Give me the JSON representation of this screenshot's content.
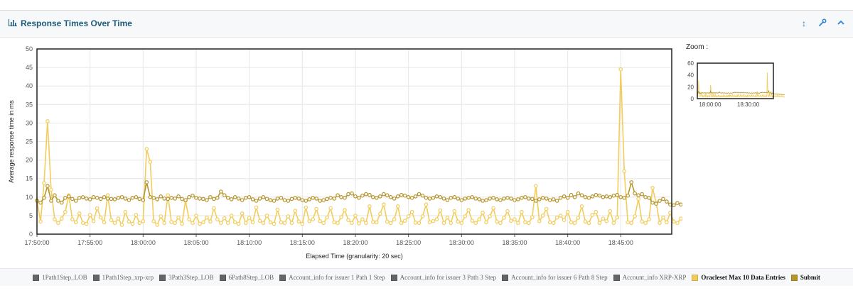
{
  "panel": {
    "title": "Response Times Over Time",
    "title_icon": "bar-chart-icon",
    "actions": [
      {
        "name": "reset-zoom-icon",
        "glyph": "↕"
      },
      {
        "name": "settings-wrench-icon",
        "glyph": "🔧"
      },
      {
        "name": "collapse-chevron-icon",
        "glyph": "⌃"
      }
    ]
  },
  "zoom": {
    "label": "Zoom :",
    "y_ticks": [
      "60",
      "40",
      "20",
      "0"
    ],
    "x_ticks": [
      "18:00:00",
      "18:30:00"
    ]
  },
  "chart_data": {
    "type": "line",
    "title": "",
    "xlabel": "Elapsed Time (granularity: 20 sec)",
    "ylabel": "Average response time in ms",
    "ylim": [
      0,
      50
    ],
    "yticks": [
      0,
      5,
      10,
      15,
      20,
      25,
      30,
      35,
      40,
      45,
      50
    ],
    "xlim": [
      "17:50:00",
      "17:59:50"
    ],
    "x_tick_labels": [
      "17:50:00",
      "17:55:00",
      "18:00:00",
      "18:05:00",
      "18:10:00",
      "18:15:00",
      "18:20:00",
      "18:25:00",
      "18:30:00",
      "18:35:00",
      "18:40:00",
      "18:45:00"
    ],
    "x_tick_minutes": [
      0,
      5,
      10,
      15,
      20,
      25,
      30,
      35,
      40,
      45,
      50,
      55
    ],
    "x_end_minutes": 59.8,
    "point_interval_minutes": 0.3333,
    "grid": true,
    "legend_position": "bottom",
    "series": [
      {
        "name": "Oracleset Max 10 Data Entries",
        "color": "#f2cd5c",
        "values": [
          9.2,
          3.4,
          13.8,
          30.5,
          12.0,
          4.0,
          3.0,
          4.2,
          6.0,
          10.5,
          4.0,
          3.2,
          5.6,
          3.0,
          2.8,
          5.2,
          3.5,
          7.0,
          4.5,
          3.2,
          10.5,
          3.8,
          3.0,
          4.2,
          2.5,
          6.0,
          3.4,
          2.8,
          5.2,
          3.0,
          3.5,
          23.0,
          19.5,
          3.5,
          2.5,
          4.8,
          3.0,
          10.5,
          3.3,
          3.0,
          4.5,
          2.8,
          9.0,
          4.0,
          3.0,
          5.0,
          2.8,
          3.2,
          4.5,
          3.4,
          7.0,
          4.0,
          3.0,
          4.3,
          3.0,
          5.0,
          3.2,
          2.8,
          5.6,
          3.0,
          4.4,
          3.2,
          7.2,
          3.6,
          3.0,
          5.0,
          3.2,
          2.8,
          6.6,
          3.2,
          3.0,
          4.8,
          3.0,
          6.3,
          3.4,
          2.8,
          7.2,
          3.5,
          4.0,
          6.8,
          3.5,
          3.0,
          4.5,
          7.0,
          3.2,
          3.0,
          4.6,
          6.5,
          3.8,
          3.0,
          5.0,
          2.9,
          4.0,
          3.0,
          7.5,
          3.3,
          3.2,
          5.5,
          8.0,
          3.4,
          3.0,
          4.0,
          7.5,
          3.0,
          3.6,
          4.8,
          6.0,
          3.1,
          3.0,
          4.8,
          8.0,
          3.2,
          3.5,
          4.0,
          6.4,
          3.0,
          4.5,
          3.0,
          6.2,
          3.4,
          3.0,
          4.8,
          6.5,
          3.6,
          3.0,
          4.0,
          5.8,
          3.2,
          4.8,
          7.0,
          3.4,
          3.0,
          4.4,
          6.2,
          3.6,
          4.0,
          3.0,
          6.0,
          3.2,
          3.0,
          4.6,
          13.0,
          3.5,
          5.0,
          6.8,
          3.2,
          3.0,
          4.5,
          5.0,
          3.8,
          6.0,
          3.2,
          3.0,
          4.4,
          7.5,
          3.4,
          3.0,
          5.2,
          6.0,
          3.0,
          4.2,
          3.5,
          6.2,
          3.0,
          4.5,
          44.5,
          17.0,
          3.2,
          3.0,
          4.8,
          9.5,
          3.4,
          3.0,
          4.0,
          12.5,
          8.5,
          3.0,
          4.5,
          3.2,
          5.8,
          3.4,
          3.0,
          4.2,
          3.5,
          5.0,
          3.0,
          3.4,
          4.0,
          3.2,
          6.5,
          3.5,
          3.0,
          4.4,
          5.8,
          3.0,
          3.4,
          4.2,
          3.2,
          5.0,
          3.5,
          3.2,
          4.6,
          3.0,
          4.0,
          3.0,
          2.2,
          2.5
        ]
      },
      {
        "name": "Submit",
        "color": "#b5952d",
        "values": [
          9.0,
          8.5,
          9.8,
          13.0,
          9.0,
          10.5,
          9.0,
          8.5,
          9.8,
          10.2,
          9.5,
          9.0,
          9.8,
          10.0,
          9.6,
          9.4,
          10.0,
          9.8,
          9.5,
          10.0,
          9.6,
          9.5,
          9.4,
          9.8,
          10.0,
          9.6,
          9.2,
          9.8,
          10.0,
          9.5,
          9.2,
          14.0,
          10.0,
          9.8,
          9.4,
          10.2,
          9.6,
          9.5,
          9.8,
          9.6,
          10.2,
          9.5,
          9.2,
          10.0,
          10.4,
          9.8,
          9.6,
          9.5,
          9.2,
          10.0,
          9.5,
          9.8,
          11.5,
          10.5,
          9.8,
          9.4,
          10.0,
          9.6,
          9.2,
          9.8,
          10.0,
          9.4,
          9.0,
          9.6,
          10.0,
          9.5,
          9.2,
          9.0,
          9.6,
          9.8,
          9.2,
          9.0,
          9.5,
          9.8,
          9.6,
          9.2,
          9.0,
          9.4,
          9.8,
          9.6,
          9.0,
          9.2,
          9.5,
          9.8,
          9.6,
          10.5,
          10.0,
          9.8,
          10.8,
          11.0,
          10.2,
          9.8,
          10.4,
          10.8,
          10.6,
          10.0,
          9.8,
          10.2,
          10.8,
          10.5,
          10.0,
          9.6,
          10.2,
          10.6,
          10.4,
          10.0,
          9.8,
          10.2,
          10.8,
          10.4,
          9.8,
          9.6,
          9.8,
          10.2,
          10.0,
          9.6,
          9.2,
          9.8,
          10.0,
          9.6,
          9.2,
          9.6,
          9.8,
          10.0,
          9.6,
          9.4,
          9.0,
          9.2,
          9.6,
          9.8,
          9.4,
          9.2,
          9.6,
          9.8,
          9.6,
          9.2,
          9.4,
          9.8,
          10.0,
          9.6,
          9.5,
          9.0,
          9.4,
          9.8,
          9.6,
          9.2,
          9.4,
          9.0,
          9.8,
          10.2,
          9.8,
          10.6,
          10.0,
          11.0,
          10.5,
          10.0,
          9.8,
          10.2,
          10.6,
          10.4,
          10.0,
          10.2,
          10.0,
          10.4,
          10.6,
          10.0,
          9.8,
          10.4,
          14.0,
          11.0,
          10.5,
          10.8,
          10.0,
          9.8,
          8.5,
          8.2,
          9.0,
          9.5,
          8.8,
          8.0,
          7.8,
          8.4,
          8.0,
          7.6,
          8.2,
          7.8,
          8.0,
          7.6,
          7.4,
          7.8,
          8.0,
          7.6,
          7.4,
          7.2,
          7.6,
          7.0,
          7.2,
          7.4,
          7.0,
          6.8,
          7.2,
          7.0,
          6.8,
          6.6,
          6.5,
          6.2,
          6.0
        ]
      }
    ]
  },
  "legend": [
    {
      "label": "1Path1Step_LOB",
      "color": "#666666",
      "active": false
    },
    {
      "label": "1Path1Step_xrp-xrp",
      "color": "#666666",
      "active": false
    },
    {
      "label": "3Path3Step_LOB",
      "color": "#666666",
      "active": false
    },
    {
      "label": "6Path8Step_LOB",
      "color": "#666666",
      "active": false
    },
    {
      "label": "Account_info for issuer 1 Path 1 Step",
      "color": "#666666",
      "active": false
    },
    {
      "label": "Account_info for issuer 3 Path 3 Step",
      "color": "#666666",
      "active": false
    },
    {
      "label": "Account_info for issuer 6 Path 8 Step",
      "color": "#666666",
      "active": false
    },
    {
      "label": "Account_info XRP-XRP",
      "color": "#666666",
      "active": false
    },
    {
      "label": "Oracleset Max 10 Data Entries",
      "color": "#f2cd5c",
      "active": true
    },
    {
      "label": "Submit",
      "color": "#b5952d",
      "active": true
    }
  ]
}
